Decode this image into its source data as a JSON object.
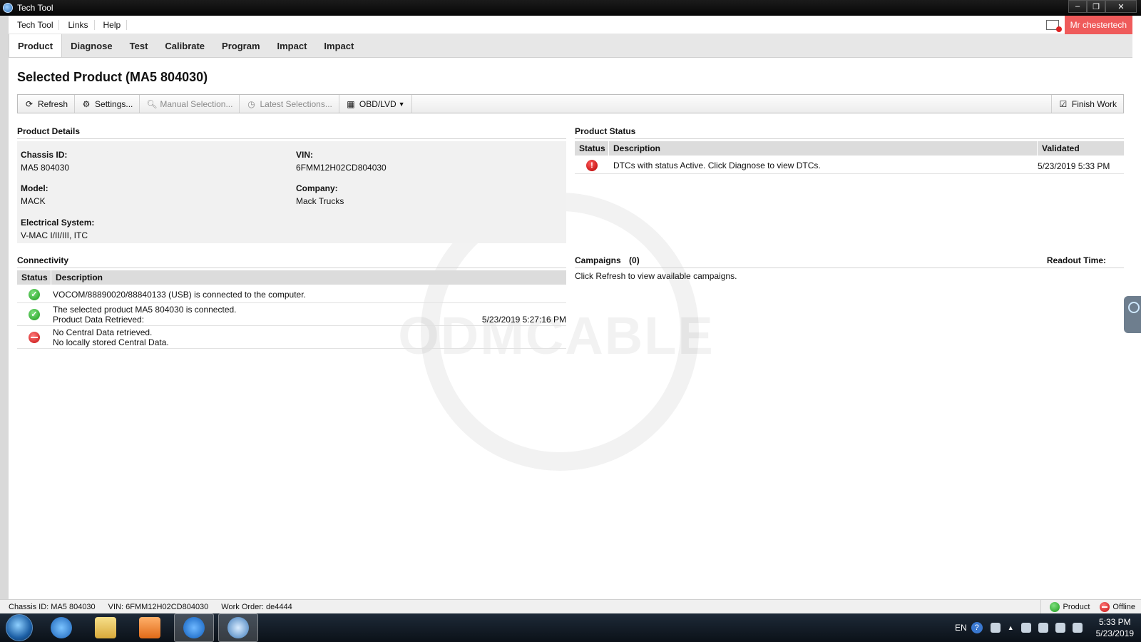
{
  "window": {
    "title": "Tech Tool"
  },
  "menu": {
    "items": [
      "Tech Tool",
      "Links",
      "Help"
    ],
    "user": "Mr chestertech"
  },
  "tabs": [
    "Product",
    "Diagnose",
    "Test",
    "Calibrate",
    "Program",
    "Impact",
    "Impact"
  ],
  "page": {
    "title": "Selected Product (MA5 804030)"
  },
  "toolbar": {
    "refresh": "Refresh",
    "settings": "Settings...",
    "manual_selection": "Manual Selection...",
    "latest_selections": "Latest Selections...",
    "obd": "OBD/LVD",
    "finish_work": "Finish Work"
  },
  "product_details": {
    "heading": "Product Details",
    "chassis_id_label": "Chassis ID:",
    "chassis_id": "MA5 804030",
    "vin_label": "VIN:",
    "vin": "6FMM12H02CD804030",
    "model_label": "Model:",
    "model": "MACK",
    "company_label": "Company:",
    "company": "Mack Trucks",
    "electrical_label": "Electrical System:",
    "electrical": "V-MAC I/II/III, ITC"
  },
  "product_status": {
    "heading": "Product Status",
    "columns": [
      "Status",
      "Description",
      "Validated"
    ],
    "rows": [
      {
        "description": "DTCs with status Active. Click Diagnose to view DTCs.",
        "validated": "5/23/2019 5:33 PM"
      }
    ]
  },
  "connectivity": {
    "heading": "Connectivity",
    "columns": [
      "Status",
      "Description"
    ],
    "rows": [
      {
        "line1": "VOCOM/88890020/88840133 (USB) is connected to the computer.",
        "line2": "",
        "time": ""
      },
      {
        "line1": "The selected product MA5 804030 is connected.",
        "line2": "Product Data Retrieved:",
        "time": "5/23/2019 5:27:16 PM"
      },
      {
        "line1": "No Central Data retrieved.",
        "line2": "No locally stored Central Data.",
        "time": ""
      }
    ]
  },
  "campaigns": {
    "heading": "Campaigns",
    "count": "(0)",
    "readout_label": "Readout Time:",
    "message": "Click Refresh to view available campaigns."
  },
  "watermark": "ODMCABLE",
  "statusbar": {
    "chassis": "Chassis ID: MA5 804030",
    "vin": "VIN: 6FMM12H02CD804030",
    "work_order": "Work Order: de4444",
    "product": "Product",
    "offline": "Offline"
  },
  "taskbar": {
    "lang": "EN",
    "time": "5:33 PM",
    "date": "5/23/2019"
  },
  "colors": {
    "user_badge": "#ef5b5b",
    "ok": "#1c9a1c",
    "error": "#c40d0d"
  }
}
